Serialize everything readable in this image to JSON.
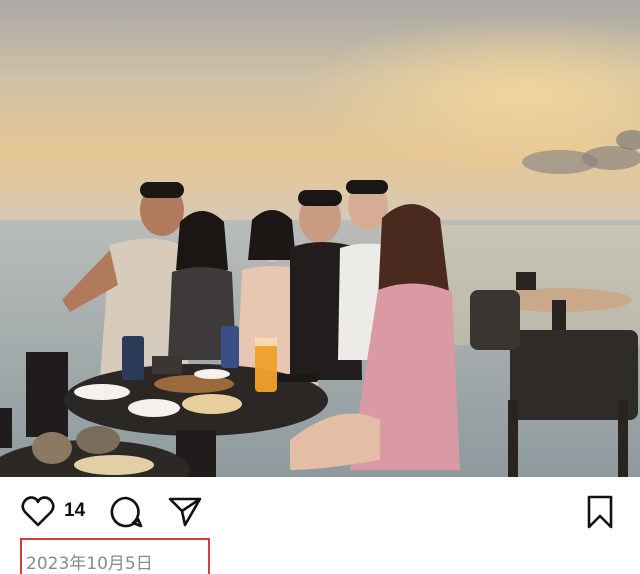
{
  "post": {
    "likes": "14",
    "date": "2023年10月5日"
  },
  "icons": {
    "like": "heart-icon",
    "comment": "comment-bubble-icon",
    "share": "paper-plane-icon",
    "save": "bookmark-icon"
  },
  "colors": {
    "icon": "#111111",
    "date_text": "#8a8a8a",
    "highlight_border": "#d93a3a"
  }
}
